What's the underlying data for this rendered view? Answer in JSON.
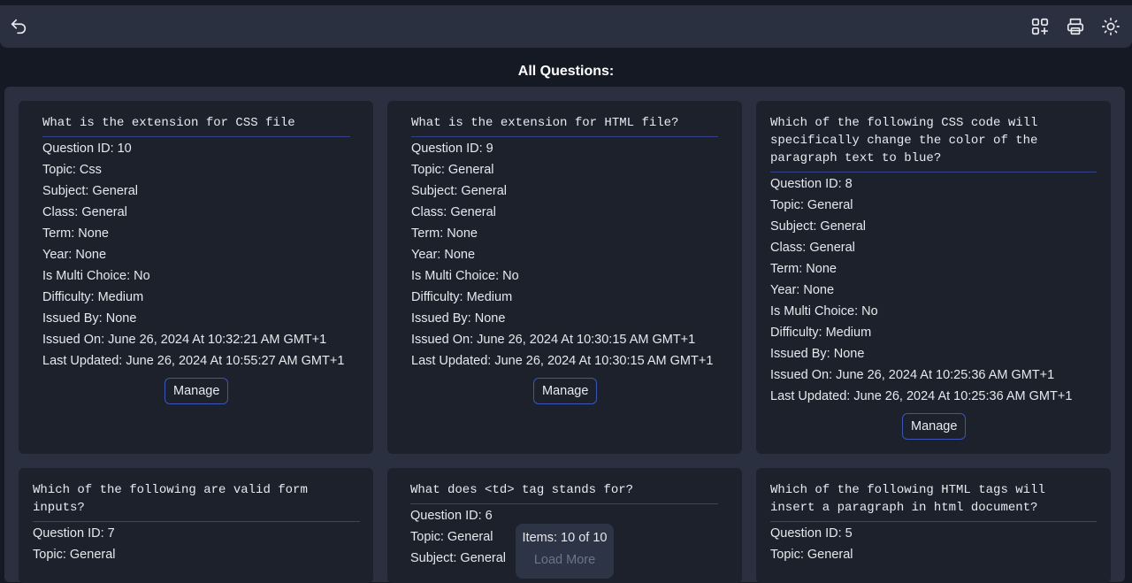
{
  "page": {
    "title": "All Questions:"
  },
  "cards": [
    {
      "question": "What is the extension for CSS file",
      "fields": [
        "Question ID: 10",
        "Topic: Css",
        "Subject: General",
        "Class: General",
        "Term: None",
        "Year: None",
        "Is Multi Choice: No",
        "Difficulty: Medium",
        "Issued By: None",
        "Issued On: June 26, 2024 At 10:32:21 AM GMT+1",
        "Last Updated: June 26, 2024 At 10:55:27 AM GMT+1"
      ],
      "manage_label": "Manage"
    },
    {
      "question": "What is the extension for HTML file?",
      "fields": [
        "Question ID: 9",
        "Topic: General",
        "Subject: General",
        "Class: General",
        "Term: None",
        "Year: None",
        "Is Multi Choice: No",
        "Difficulty: Medium",
        "Issued By: None",
        "Issued On: June 26, 2024 At 10:30:15 AM GMT+1",
        "Last Updated: June 26, 2024 At 10:30:15 AM GMT+1"
      ],
      "manage_label": "Manage"
    },
    {
      "question": "Which of the following CSS code will\nspecifically change the color of the\nparagraph text to blue?",
      "fields": [
        "Question ID: 8",
        "Topic: General",
        "Subject: General",
        "Class: General",
        "Term: None",
        "Year: None",
        "Is Multi Choice: No",
        "Difficulty: Medium",
        "Issued By: None",
        "Issued On: June 26, 2024 At 10:25:36 AM GMT+1",
        "Last Updated: June 26, 2024 At 10:25:36 AM GMT+1"
      ],
      "manage_label": "Manage"
    },
    {
      "question": "Which of the following are valid form\ninputs?",
      "fields": [
        "Question ID: 7",
        "Topic: General"
      ]
    },
    {
      "question": "What does <td> tag stands for?",
      "fields": [
        "Question ID: 6",
        "Topic: General",
        "Subject: General"
      ]
    },
    {
      "question": "Which of the following HTML tags will\ninsert a paragraph in html document?",
      "fields": [
        "Question ID: 5",
        "Topic: General"
      ]
    }
  ],
  "pagination": {
    "items_label": "Items: 10 of 10",
    "load_more_label": "Load More"
  },
  "icons": {
    "back": "undo-arrow-icon",
    "add": "add-grid-icon",
    "print": "printer-icon",
    "theme": "sun-icon"
  }
}
